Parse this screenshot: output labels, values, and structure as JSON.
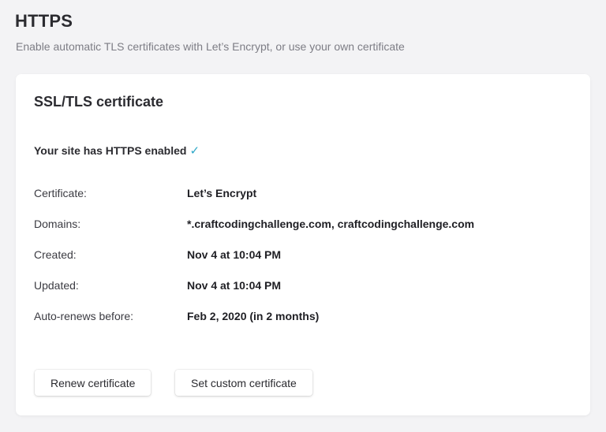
{
  "header": {
    "title": "HTTPS",
    "subtitle": "Enable automatic TLS certificates with Let’s Encrypt, or use your own certificate"
  },
  "card": {
    "title": "SSL/TLS certificate",
    "status_text": "Your site has HTTPS enabled",
    "status_icon": "check-icon",
    "check_glyph": "✓",
    "rows": [
      {
        "label": "Certificate:",
        "value": "Let’s Encrypt"
      },
      {
        "label": "Domains:",
        "value": "*.craftcodingchallenge.com, craftcodingchallenge.com"
      },
      {
        "label": "Created:",
        "value": "Nov 4 at 10:04 PM"
      },
      {
        "label": "Updated:",
        "value": "Nov 4 at 10:04 PM"
      },
      {
        "label": "Auto-renews before:",
        "value": "Feb 2, 2020 (in 2 months)"
      }
    ],
    "buttons": {
      "renew_label": "Renew certificate",
      "custom_label": "Set custom certificate"
    }
  },
  "colors": {
    "background": "#f3f3f5",
    "card": "#ffffff",
    "accent_check": "#2fa8c8"
  }
}
